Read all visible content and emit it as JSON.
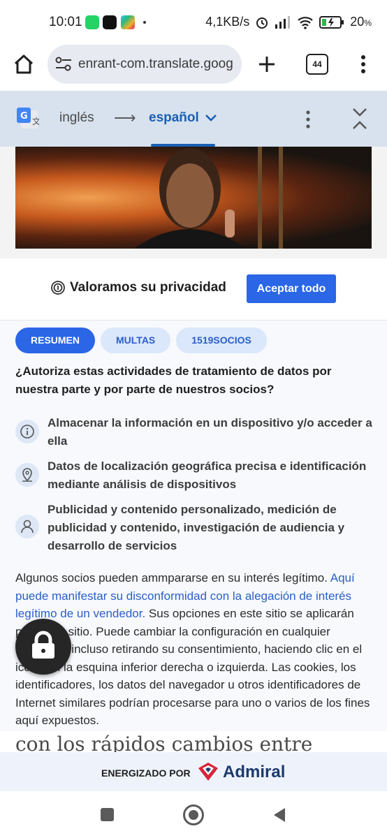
{
  "status_bar": {
    "time": "10:01",
    "network_speed": "4,1KB/s",
    "battery": "20",
    "battery_unit": "%"
  },
  "browser": {
    "url": "enrant-com.translate.goog",
    "tab_count": "44"
  },
  "translate_bar": {
    "source_lang": "inglés",
    "arrow": "⟶",
    "target_lang": "español"
  },
  "consent": {
    "title": "Valoramos su privacidad",
    "accept_label": "Aceptar todo",
    "tabs": [
      {
        "label": "RESUMEN",
        "active": true
      },
      {
        "label": "MULTAS",
        "active": false
      },
      {
        "label": "1519SOCIOS",
        "active": false
      }
    ],
    "question": "¿Autoriza estas actividades de tratamiento de datos por nuestra parte y por parte de nuestros socios?",
    "purposes": [
      {
        "icon": "info-icon",
        "text": "Almacenar la información en un dispositivo y/o acceder a ella"
      },
      {
        "icon": "location-pin-icon",
        "text": "Datos de localización geográfica precisa e identificación mediante análisis de dispositivos"
      },
      {
        "icon": "person-icon",
        "text": "Publicidad y contenido personalizado, medición de publicidad y contenido, investigación de audiencia y desarrollo de servicios"
      }
    ],
    "legal_intro": "Algunos socios pueden ammpararse en su interés legítimo. ",
    "legal_link": "Aquí puede manifestar su disconformidad con la alegación de interés legítimo de un vendedor.",
    "legal_rest": " Sus opciones en este sitio se aplicarán para este sitio. Puede cambiar la configuración en cualquier momento, incluso retirando su consentimiento, haciendo clic en el icono en la esquina inferior derecha o izquierda. Las cookies, los identificadores, los datos del navegador u otros identificadores de Internet similares podrían procesarse para uno o varios de los fines aquí expuestos."
  },
  "article": {
    "snippet": "con los rápidos cambios entre"
  },
  "footer": {
    "powered_by": "ENERGIZADO POR",
    "brand": "Admiral"
  },
  "colors": {
    "accent": "#2a66e6",
    "link": "#2a5fc9",
    "translate_bar": "#d7e2ee"
  }
}
